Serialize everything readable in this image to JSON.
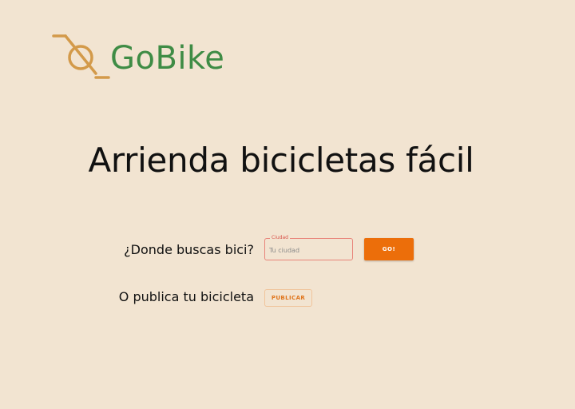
{
  "brand": {
    "name": "GoBike",
    "icon": "bike-logo-icon",
    "logo_icon_color": "#D39A4A",
    "name_color": "#3F8C45"
  },
  "hero": {
    "title": "Arrienda bicicletas fácil"
  },
  "search": {
    "prompt": "¿Donde buscas bici?",
    "field_label": "Ciudad",
    "placeholder": "Tu ciudad",
    "value": "",
    "button_label": "GO!"
  },
  "publish": {
    "prompt": "O publica tu bicicleta",
    "button_label": "PUBLICAR"
  },
  "colors": {
    "background": "#F2E4D1",
    "accent": "#EC6E0A",
    "field_border": "#E8847A"
  }
}
